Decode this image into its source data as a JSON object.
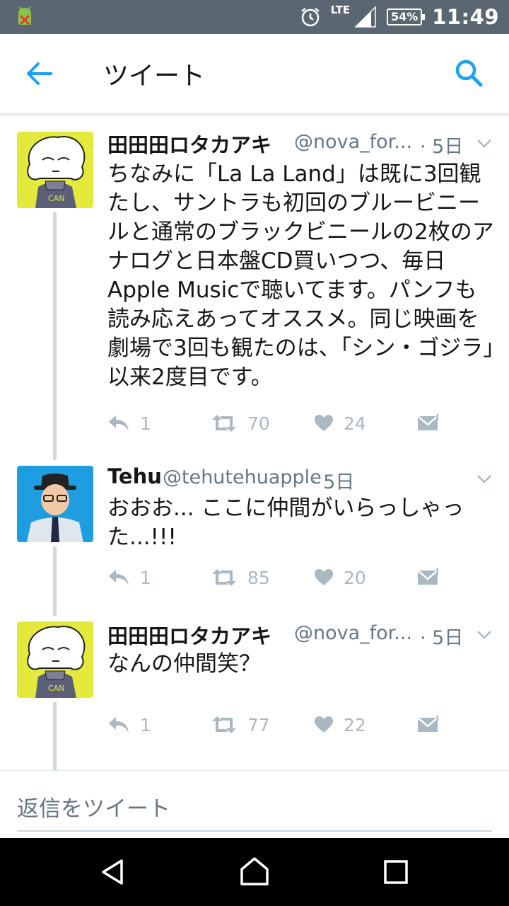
{
  "status_bar": {
    "network": "LTE",
    "battery": "54%",
    "time": "11:49"
  },
  "app_bar": {
    "title": "ツイート"
  },
  "tweets": [
    {
      "name": "田田田ロタカアキ",
      "handle": "@nova_for...",
      "time": "· 5日",
      "text": "ちなみに「La La Land」は既に3回観たし、サントラも初回のブルービニールと通常のブラックビニールの2枚のアナログと日本盤CD買いつつ、毎日Apple Musicで聴いてます。パンフも読み応えあってオススメ。同じ映画を劇場で3回も観たのは、「シン・ゴジラ」以来2度目です。",
      "replies": "1",
      "retweets": "70",
      "likes": "24"
    },
    {
      "name": "Tehu",
      "handle": "@tehutehuapple",
      "time": "· 5日",
      "text": "おおお... ここに仲間がいらっしゃった...!!!",
      "replies": "1",
      "retweets": "85",
      "likes": "20"
    },
    {
      "name": "田田田ロタカアキ",
      "handle": "@nova_for...",
      "time": "· 5日",
      "text": "なんの仲間笑？",
      "replies": "1",
      "retweets": "77",
      "likes": "22"
    }
  ],
  "reply_bar": {
    "placeholder": "返信をツイート"
  },
  "colors": {
    "accent": "#1da1f2",
    "status_bar": "#5a6772",
    "secondary_text": "#657786",
    "action_icon": "#aab8c2"
  }
}
